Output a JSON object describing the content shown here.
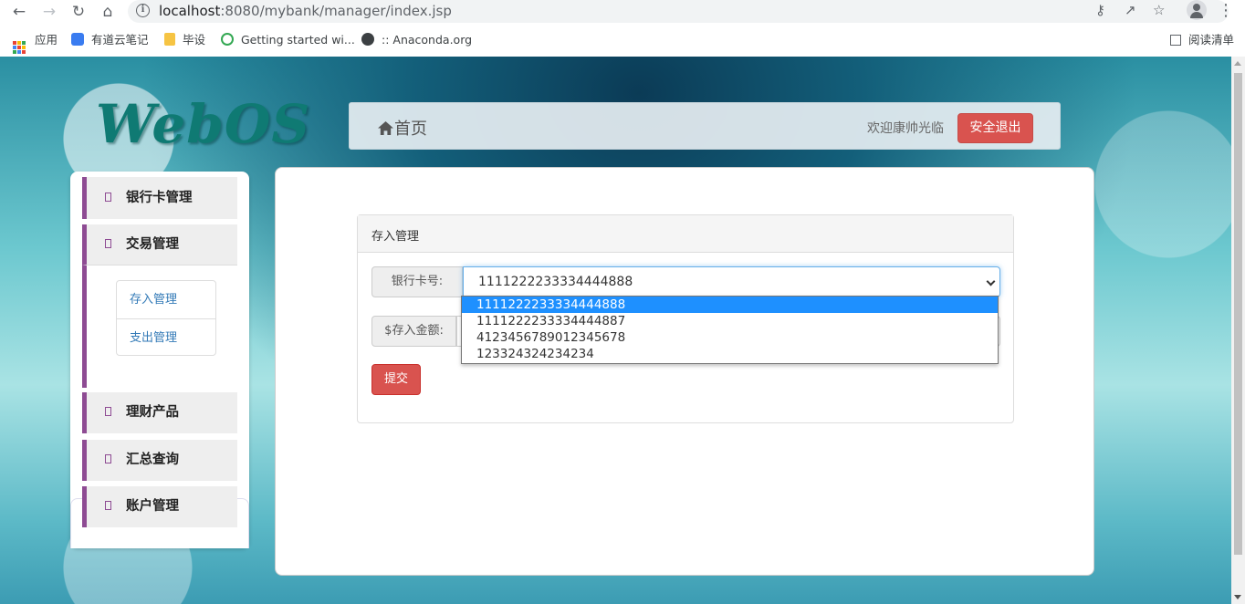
{
  "browser": {
    "url_host": "localhost",
    "url_rest": ":8080/mybank/manager/index.jsp",
    "bookmarks": [
      {
        "label": "应用"
      },
      {
        "label": "有道云笔记"
      },
      {
        "label": "毕设"
      },
      {
        "label": "Getting started wi..."
      },
      {
        "label": ":: Anaconda.org"
      }
    ],
    "reading_list": "阅读清单"
  },
  "header": {
    "logo": "WebOS",
    "home_label": "首页",
    "welcome": "欢迎康帅光临",
    "logout_label": "安全退出"
  },
  "sidebar": {
    "items": [
      {
        "label": "银行卡管理"
      },
      {
        "label": "交易管理"
      },
      {
        "label": "理财产品"
      },
      {
        "label": "汇总查询"
      },
      {
        "label": "账户管理"
      }
    ],
    "sub_items": [
      {
        "label": "存入管理"
      },
      {
        "label": "支出管理"
      }
    ]
  },
  "panel": {
    "title": "存入管理",
    "card_label": "银行卡号:",
    "amount_label": "$存入金额:",
    "selected_card": "1111222233334444888",
    "card_options": [
      "1111222233334444888",
      "1111222233334444887",
      "4123456789012345678",
      "123324324234234"
    ],
    "submit_label": "提交"
  },
  "colors": {
    "accent_purple": "#8e4b93",
    "danger": "#d9534f",
    "link": "#337ab7",
    "option_highlight": "#1e90ff"
  }
}
